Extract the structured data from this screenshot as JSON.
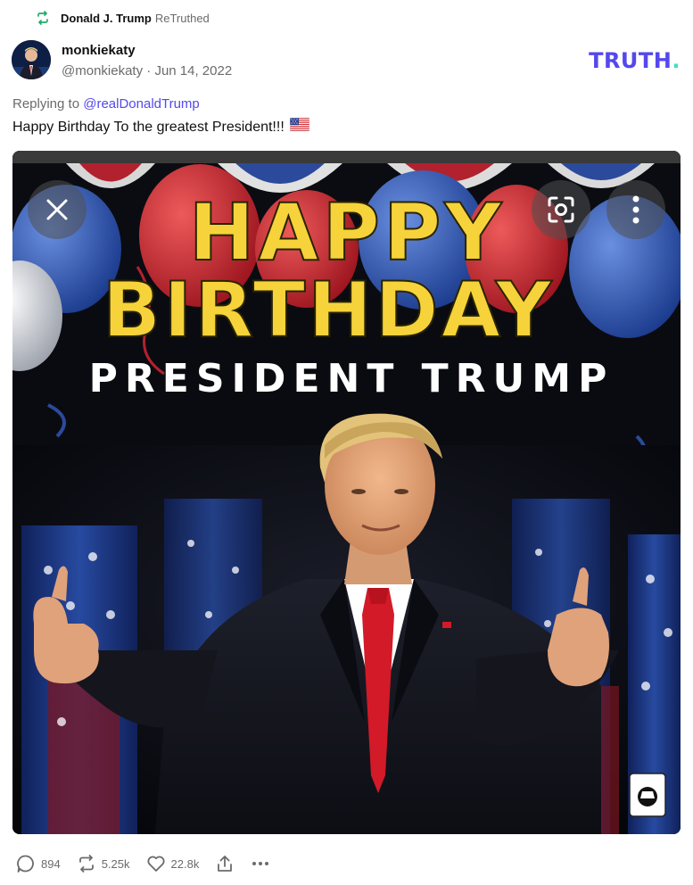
{
  "retruth": {
    "user": "Donald J. Trump",
    "verb": "ReTruthed",
    "icon": "retruth-icon"
  },
  "post": {
    "display_name": "monkiekaty",
    "handle": "@monkiekaty",
    "separator": "·",
    "date": "Jun 14, 2022",
    "reply_prefix": "Replying to",
    "reply_to": "@realDonaldTrump",
    "text": "Happy Birthday To the greatest President!!!",
    "emoji": "us-flag-emoji"
  },
  "brand": {
    "text": "TRUTH",
    "dot": ".",
    "color": "#5448ee",
    "dot_color": "#3ee0c9"
  },
  "media": {
    "line1": "HAPPY",
    "line2": "BIRTHDAY",
    "line3": "PRESIDENT TRUMP",
    "title_color": "#f6d33a",
    "subtitle_color": "#ffffff",
    "controls": [
      "close-icon",
      "lens-icon",
      "more-vertical-icon"
    ]
  },
  "actions": {
    "replies": "894",
    "retruths": "5.25k",
    "likes": "22.8k"
  }
}
